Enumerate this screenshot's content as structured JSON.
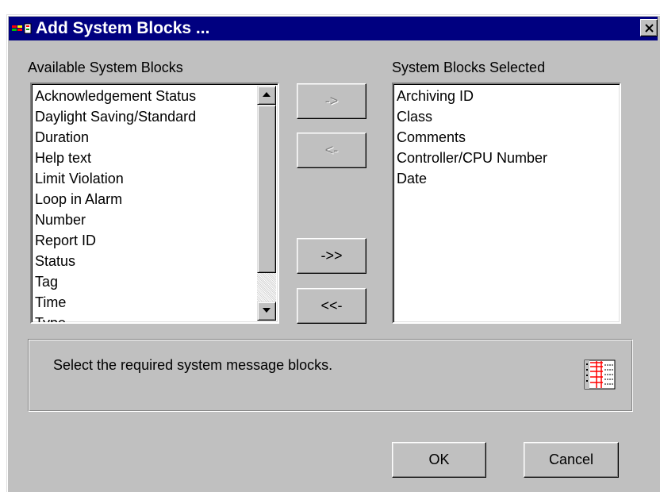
{
  "dialog": {
    "title": "Add System Blocks ...",
    "icons": {
      "app": "app-icon",
      "close": "close-icon"
    }
  },
  "available": {
    "label": "Available System Blocks",
    "items": [
      "Acknowledgement Status",
      "Daylight Saving/Standard",
      "Duration",
      "Help text",
      "Limit Violation",
      "Loop in Alarm",
      "Number",
      "Report ID",
      "Status",
      "Tag",
      "Time",
      "Type"
    ]
  },
  "selected": {
    "label": "System Blocks Selected",
    "items": [
      "Archiving ID",
      "Class",
      "Comments",
      "Controller/CPU Number",
      "Date"
    ]
  },
  "buttons": {
    "add": "->",
    "remove": "<-",
    "add_all": "->>",
    "remove_all": "<<-",
    "ok": "OK",
    "cancel": "Cancel"
  },
  "info": {
    "text": "Select the required system message blocks.",
    "icon": "message-blocks-icon"
  },
  "colors": {
    "title_bar": "#000080",
    "face": "#c0c0c0",
    "disabled_text": "#808080"
  }
}
